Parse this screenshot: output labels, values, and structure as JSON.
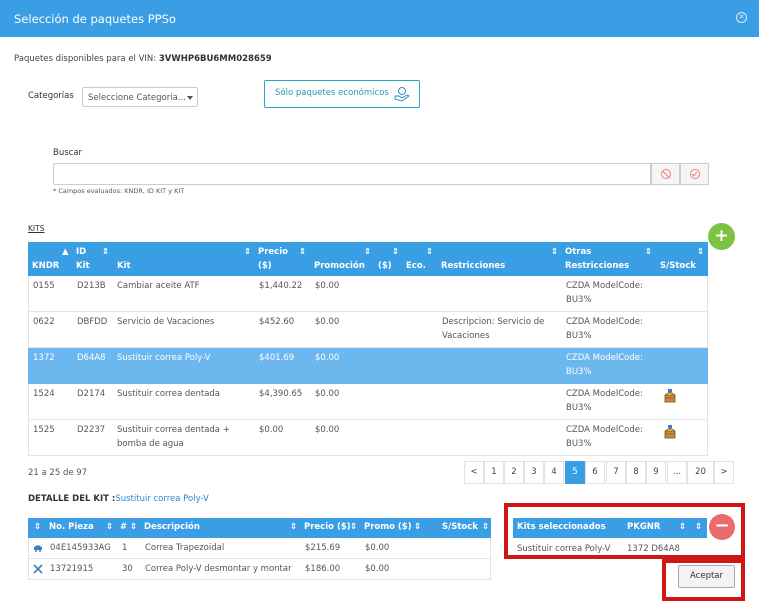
{
  "window": {
    "title": "Selección de paquetes PPSo"
  },
  "vin": {
    "label": "Paquetes disponibles para el VIN:",
    "value": "3VWHP6BU6MM028659"
  },
  "filters": {
    "category_label": "Categorías",
    "category_value": "Seleccione Categoria...",
    "eco_button": "Sólo paquetes económicos"
  },
  "search": {
    "label": "Buscar",
    "value": "",
    "note": "* Campos evaluados: KNDR, ID KIT y KIT"
  },
  "kits": {
    "section_label": "KITS",
    "headers": {
      "kndr": "KNDR",
      "id_kit_1": "ID",
      "id_kit_2": "Kit",
      "kit": "Kit",
      "precio_1": "Precio",
      "precio_2": "($)",
      "promocion": "Promoción",
      "dollar": "($)",
      "eco": "Eco.",
      "restricciones": "Restricciones",
      "otras_1": "Otras",
      "otras_2": "Restricciones",
      "stock": "S/Stock"
    },
    "rows": [
      {
        "kndr": "0155",
        "id": "D213B",
        "kit_1": "Cambiar aceite ATF",
        "kit_2": "",
        "precio": "$1,440.22",
        "promo": "$0.00",
        "restr_1": "",
        "restr_2": "",
        "otras_1": "CZDA ModelCode:",
        "otras_2": "BU3%",
        "stock": false,
        "selected": false
      },
      {
        "kndr": "0622",
        "id": "DBFDD",
        "kit_1": "Servicio de Vacaciones",
        "kit_2": "",
        "precio": "$452.60",
        "promo": "$0.00",
        "restr_1": "Descripcion: Servicio de",
        "restr_2": "Vacaciones",
        "otras_1": "CZDA ModelCode:",
        "otras_2": "BU3%",
        "stock": false,
        "selected": false
      },
      {
        "kndr": "1372",
        "id": "D64A8",
        "kit_1": "Sustituir correa Poly-V",
        "kit_2": "",
        "precio": "$401.69",
        "promo": "$0.00",
        "restr_1": "",
        "restr_2": "",
        "otras_1": "CZDA ModelCode:",
        "otras_2": "BU3%",
        "stock": false,
        "selected": true
      },
      {
        "kndr": "1524",
        "id": "D2174",
        "kit_1": "Sustituir correa dentada",
        "kit_2": "",
        "precio": "$4,390.65",
        "promo": "$0.00",
        "restr_1": "",
        "restr_2": "",
        "otras_1": "CZDA ModelCode:",
        "otras_2": "BU3%",
        "stock": true,
        "selected": false
      },
      {
        "kndr": "1525",
        "id": "D2237",
        "kit_1": "Sustituir correa dentada +",
        "kit_2": "bomba de agua",
        "precio": "$0.00",
        "promo": "$0.00",
        "restr_1": "",
        "restr_2": "",
        "otras_1": "CZDA ModelCode:",
        "otras_2": "BU3%",
        "stock": true,
        "selected": false
      }
    ]
  },
  "pagination": {
    "info": "21 a 25 de 97",
    "prev": "<",
    "next": ">",
    "ellipsis": "...",
    "pages": [
      "1",
      "2",
      "3",
      "4",
      "5",
      "6",
      "7",
      "8",
      "9",
      "20"
    ],
    "current": "5"
  },
  "detail": {
    "label": "DETALLE DEL KIT :",
    "kit_name": "Sustituir correa Poly-V",
    "headers": {
      "pieza": "No. Pieza",
      "num": "#",
      "descripcion": "Descripción",
      "precio": "Precio ($)",
      "promo": "Promo ($)",
      "stock": "S/Stock"
    },
    "rows": [
      {
        "icon": "car-icon",
        "pieza": "04E145933AG",
        "num": "1",
        "descripcion": "Correa Trapezoidal",
        "precio": "$215.69",
        "promo": "$0.00"
      },
      {
        "icon": "tools-icon",
        "pieza": "13721915",
        "num": "30",
        "descripcion": "Correa Poly-V desmontar y montar",
        "precio": "$186.00",
        "promo": "$0.00"
      }
    ]
  },
  "selected_kits": {
    "headers": {
      "kits": "Kits seleccionados",
      "pkgnr": "PKGNR"
    },
    "rows": [
      {
        "kit": "Sustituir correa Poly-V",
        "pkgnr": "1372 D64A8"
      }
    ]
  },
  "actions": {
    "accept": "Aceptar",
    "add": "+",
    "remove": "−"
  },
  "colors": {
    "header_blue": "#3a9ee4",
    "selected_row": "#6db7ef",
    "add_green": "#7dc242",
    "remove_red": "#ea6b6b",
    "highlight_red": "#d01717"
  }
}
